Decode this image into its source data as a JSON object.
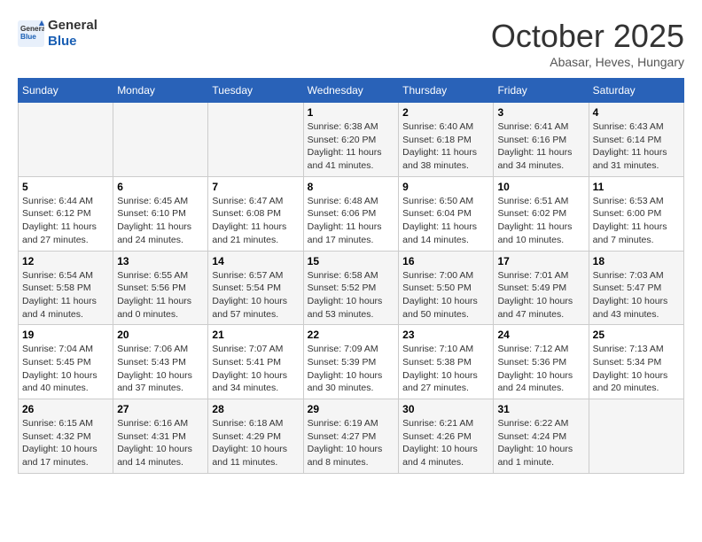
{
  "header": {
    "logo_line1": "General",
    "logo_line2": "Blue",
    "month": "October 2025",
    "location": "Abasar, Heves, Hungary"
  },
  "days_of_week": [
    "Sunday",
    "Monday",
    "Tuesday",
    "Wednesday",
    "Thursday",
    "Friday",
    "Saturday"
  ],
  "weeks": [
    [
      {
        "day": "",
        "info": ""
      },
      {
        "day": "",
        "info": ""
      },
      {
        "day": "",
        "info": ""
      },
      {
        "day": "1",
        "info": "Sunrise: 6:38 AM\nSunset: 6:20 PM\nDaylight: 11 hours\nand 41 minutes."
      },
      {
        "day": "2",
        "info": "Sunrise: 6:40 AM\nSunset: 6:18 PM\nDaylight: 11 hours\nand 38 minutes."
      },
      {
        "day": "3",
        "info": "Sunrise: 6:41 AM\nSunset: 6:16 PM\nDaylight: 11 hours\nand 34 minutes."
      },
      {
        "day": "4",
        "info": "Sunrise: 6:43 AM\nSunset: 6:14 PM\nDaylight: 11 hours\nand 31 minutes."
      }
    ],
    [
      {
        "day": "5",
        "info": "Sunrise: 6:44 AM\nSunset: 6:12 PM\nDaylight: 11 hours\nand 27 minutes."
      },
      {
        "day": "6",
        "info": "Sunrise: 6:45 AM\nSunset: 6:10 PM\nDaylight: 11 hours\nand 24 minutes."
      },
      {
        "day": "7",
        "info": "Sunrise: 6:47 AM\nSunset: 6:08 PM\nDaylight: 11 hours\nand 21 minutes."
      },
      {
        "day": "8",
        "info": "Sunrise: 6:48 AM\nSunset: 6:06 PM\nDaylight: 11 hours\nand 17 minutes."
      },
      {
        "day": "9",
        "info": "Sunrise: 6:50 AM\nSunset: 6:04 PM\nDaylight: 11 hours\nand 14 minutes."
      },
      {
        "day": "10",
        "info": "Sunrise: 6:51 AM\nSunset: 6:02 PM\nDaylight: 11 hours\nand 10 minutes."
      },
      {
        "day": "11",
        "info": "Sunrise: 6:53 AM\nSunset: 6:00 PM\nDaylight: 11 hours\nand 7 minutes."
      }
    ],
    [
      {
        "day": "12",
        "info": "Sunrise: 6:54 AM\nSunset: 5:58 PM\nDaylight: 11 hours\nand 4 minutes."
      },
      {
        "day": "13",
        "info": "Sunrise: 6:55 AM\nSunset: 5:56 PM\nDaylight: 11 hours\nand 0 minutes."
      },
      {
        "day": "14",
        "info": "Sunrise: 6:57 AM\nSunset: 5:54 PM\nDaylight: 10 hours\nand 57 minutes."
      },
      {
        "day": "15",
        "info": "Sunrise: 6:58 AM\nSunset: 5:52 PM\nDaylight: 10 hours\nand 53 minutes."
      },
      {
        "day": "16",
        "info": "Sunrise: 7:00 AM\nSunset: 5:50 PM\nDaylight: 10 hours\nand 50 minutes."
      },
      {
        "day": "17",
        "info": "Sunrise: 7:01 AM\nSunset: 5:49 PM\nDaylight: 10 hours\nand 47 minutes."
      },
      {
        "day": "18",
        "info": "Sunrise: 7:03 AM\nSunset: 5:47 PM\nDaylight: 10 hours\nand 43 minutes."
      }
    ],
    [
      {
        "day": "19",
        "info": "Sunrise: 7:04 AM\nSunset: 5:45 PM\nDaylight: 10 hours\nand 40 minutes."
      },
      {
        "day": "20",
        "info": "Sunrise: 7:06 AM\nSunset: 5:43 PM\nDaylight: 10 hours\nand 37 minutes."
      },
      {
        "day": "21",
        "info": "Sunrise: 7:07 AM\nSunset: 5:41 PM\nDaylight: 10 hours\nand 34 minutes."
      },
      {
        "day": "22",
        "info": "Sunrise: 7:09 AM\nSunset: 5:39 PM\nDaylight: 10 hours\nand 30 minutes."
      },
      {
        "day": "23",
        "info": "Sunrise: 7:10 AM\nSunset: 5:38 PM\nDaylight: 10 hours\nand 27 minutes."
      },
      {
        "day": "24",
        "info": "Sunrise: 7:12 AM\nSunset: 5:36 PM\nDaylight: 10 hours\nand 24 minutes."
      },
      {
        "day": "25",
        "info": "Sunrise: 7:13 AM\nSunset: 5:34 PM\nDaylight: 10 hours\nand 20 minutes."
      }
    ],
    [
      {
        "day": "26",
        "info": "Sunrise: 6:15 AM\nSunset: 4:32 PM\nDaylight: 10 hours\nand 17 minutes."
      },
      {
        "day": "27",
        "info": "Sunrise: 6:16 AM\nSunset: 4:31 PM\nDaylight: 10 hours\nand 14 minutes."
      },
      {
        "day": "28",
        "info": "Sunrise: 6:18 AM\nSunset: 4:29 PM\nDaylight: 10 hours\nand 11 minutes."
      },
      {
        "day": "29",
        "info": "Sunrise: 6:19 AM\nSunset: 4:27 PM\nDaylight: 10 hours\nand 8 minutes."
      },
      {
        "day": "30",
        "info": "Sunrise: 6:21 AM\nSunset: 4:26 PM\nDaylight: 10 hours\nand 4 minutes."
      },
      {
        "day": "31",
        "info": "Sunrise: 6:22 AM\nSunset: 4:24 PM\nDaylight: 10 hours\nand 1 minute."
      },
      {
        "day": "",
        "info": ""
      }
    ]
  ]
}
